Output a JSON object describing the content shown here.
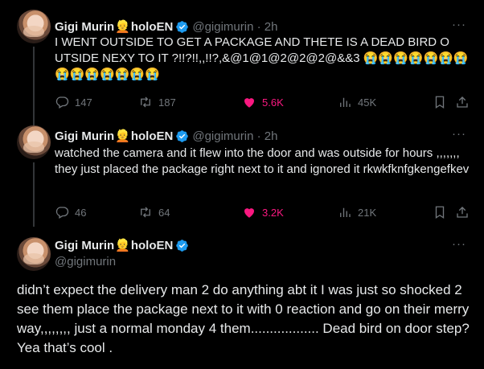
{
  "tweets": [
    {
      "name": "Gigi Murin",
      "name_emoji": "👱",
      "name_suffix": "holoEN",
      "handle": "@gigimurin · 2h",
      "more": "···",
      "text": "I WENT OUTSIDE TO GET A PACKAGE AND THETE IS A DEAD BIRD O UTSIDE NEXY TO IT ?!!?!!,,!!?,&@1@1@2@2@2@&&3 😭😭😭😭😭😭😭😭😭😭😭😭😭😭",
      "replies": "147",
      "retweets": "187",
      "likes": "5.6K",
      "views": "45K"
    },
    {
      "name": "Gigi Murin",
      "name_emoji": "👱",
      "name_suffix": "holoEN",
      "handle": "@gigimurin · 2h",
      "more": "···",
      "text": "watched the camera and it flew into the door and was outside for hours ,,,,,,, they just placed the package right next to it and ignored it rkwkfknfgkengefkev",
      "replies": "46",
      "retweets": "64",
      "likes": "3.2K",
      "views": "21K"
    },
    {
      "name": "Gigi Murin",
      "name_emoji": "👱",
      "name_suffix": "holoEN",
      "handle": "@gigimurin",
      "more": "···",
      "text": "didn’t expect the delivery man 2 do anything abt it I was just so shocked 2 see them place the package next to it with 0 reaction and go on their merry way,,,,,,,, just a normal monday 4 them.................. Dead bird on door step? Yea that’s cool ."
    }
  ],
  "colors": {
    "background": "#000000",
    "text": "#e7e9ea",
    "muted": "#71767b",
    "like": "#f91880",
    "verified": "#1d9bf0"
  },
  "icons": [
    "reply-icon",
    "retweet-icon",
    "heart-icon",
    "views-icon",
    "bookmark-icon",
    "share-icon",
    "verified-icon",
    "more-icon"
  ]
}
